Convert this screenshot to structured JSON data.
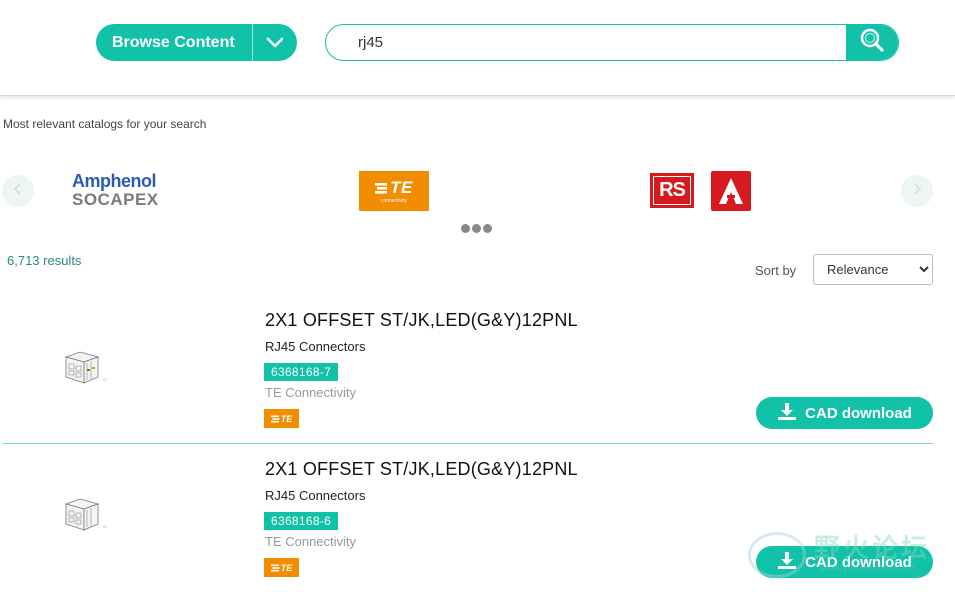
{
  "header": {
    "browse_label": "Browse Content",
    "search_value": "rj45",
    "search_placeholder": ""
  },
  "catalogs": {
    "heading": "Most relevant catalogs for your search",
    "amphenol_line1": "Amphenol",
    "amphenol_line2": "SOCAPEX",
    "te_text": "TE",
    "te_sub": "connectivity",
    "rs_text": "RS"
  },
  "results": {
    "count": "6,713 results",
    "sort_label": "Sort by",
    "sort_value": "Relevance",
    "items": [
      {
        "title": "2X1 OFFSET ST/JK,LED(G&Y)12PNL",
        "category": "RJ45 Connectors",
        "part_number": "6368168-7",
        "manufacturer": "TE Connectivity",
        "logo_text": "TE",
        "cad_label": "CAD download"
      },
      {
        "title": "2X1 OFFSET ST/JK,LED(G&Y)12PNL",
        "category": "RJ45 Connectors",
        "part_number": "6368168-6",
        "manufacturer": "TE Connectivity",
        "logo_text": "TE",
        "cad_label": "CAD download"
      }
    ]
  },
  "watermark": {
    "text": "野火论坛",
    "url": "www.proewildfire.cn"
  },
  "colors": {
    "accent": "#12c2a8",
    "te_orange": "#f28c00",
    "rs_red": "#d71920",
    "amphenol_blue": "#2a5db0"
  }
}
